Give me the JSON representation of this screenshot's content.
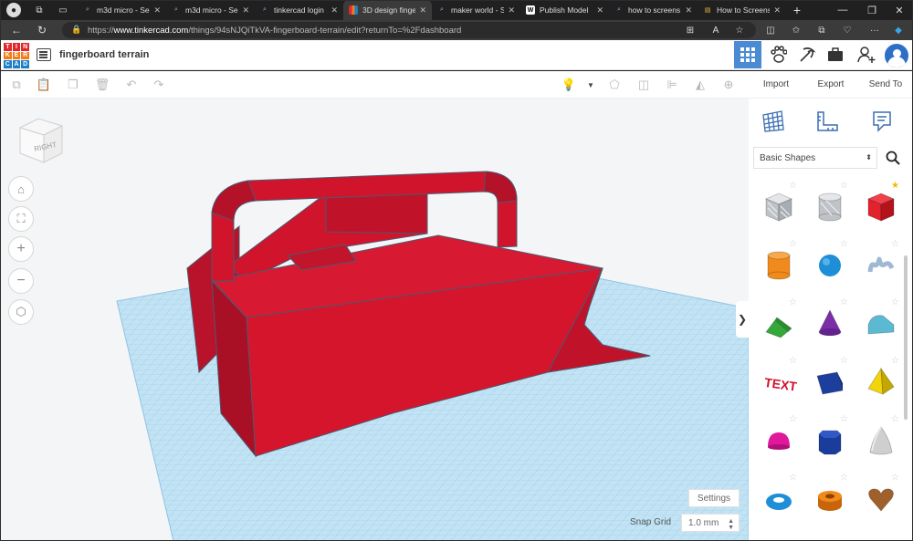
{
  "browser": {
    "tabs": [
      {
        "label": "m3d micro - Se",
        "favicon": "search-icon"
      },
      {
        "label": "m3d micro - Se",
        "favicon": "search-icon"
      },
      {
        "label": "tinkercad login",
        "favicon": "search-icon"
      },
      {
        "label": "3D design finge",
        "favicon": "tinkercad-icon",
        "active": true
      },
      {
        "label": "maker world - S",
        "favicon": "search-icon"
      },
      {
        "label": "Publish Model",
        "favicon": "makerworld-icon"
      },
      {
        "label": "how to screens",
        "favicon": "search-icon"
      },
      {
        "label": "How to Screens",
        "favicon": "article-icon"
      }
    ],
    "new_tab": "+",
    "url_prefix": "https://",
    "url_domain": "www.tinkercad.com",
    "url_path": "/things/94sNJQiTkVA-fingerboard-terrain/edit?returnTo=%2Fdashboard"
  },
  "app": {
    "logo_letters": [
      "T",
      "I",
      "N",
      "K",
      "E",
      "R",
      "C",
      "A",
      "D"
    ],
    "logo_colors": [
      "#e2272c",
      "#e2272c",
      "#e2272c",
      "#f07d1a",
      "#f07d1a",
      "#f07d1a",
      "#1e7fc7",
      "#1e7fc7",
      "#1e7fc7"
    ],
    "design_title": "fingerboard terrain",
    "panel_actions": {
      "import": "Import",
      "export": "Export",
      "send_to": "Send To"
    },
    "accent": "#4b8bd4"
  },
  "workspace": {
    "viewcube_label": "RIGHT",
    "settings_label": "Settings",
    "snap_label": "Snap Grid",
    "snap_value": "1.0 mm",
    "collapse_glyph": "❯",
    "model_color": "#d0142c"
  },
  "library": {
    "selected": "Basic Shapes",
    "shapes": [
      {
        "name": "box-hole",
        "color": "#bfc3c8",
        "favorite": false
      },
      {
        "name": "cylinder-hole",
        "color": "#bfc3c8",
        "favorite": false
      },
      {
        "name": "box",
        "color": "#e2222c",
        "favorite": true
      },
      {
        "name": "cylinder",
        "color": "#f08a1c",
        "favorite": false
      },
      {
        "name": "sphere",
        "color": "#1e8fd6",
        "favorite": false
      },
      {
        "name": "scribble",
        "color": "#9fb8d6",
        "favorite": false
      },
      {
        "name": "roof",
        "color": "#35a83a",
        "favorite": false
      },
      {
        "name": "cone",
        "color": "#7a2ea8",
        "favorite": false
      },
      {
        "name": "round-roof",
        "color": "#5bbad2",
        "favorite": false
      },
      {
        "name": "text",
        "color": "#d0142c",
        "favorite": false
      },
      {
        "name": "wedge",
        "color": "#1c3f9e",
        "favorite": false
      },
      {
        "name": "pyramid",
        "color": "#f3d40a",
        "favorite": false
      },
      {
        "name": "half-sphere",
        "color": "#e0189c",
        "favorite": false
      },
      {
        "name": "polygon",
        "color": "#1a3d9c",
        "favorite": false
      },
      {
        "name": "paraboloid",
        "color": "#cfcfcf",
        "favorite": false
      },
      {
        "name": "torus",
        "color": "#1e8fd6",
        "favorite": false
      },
      {
        "name": "tube",
        "color": "#f08a1c",
        "favorite": false
      },
      {
        "name": "heart",
        "color": "#a0602c",
        "favorite": false
      }
    ]
  }
}
